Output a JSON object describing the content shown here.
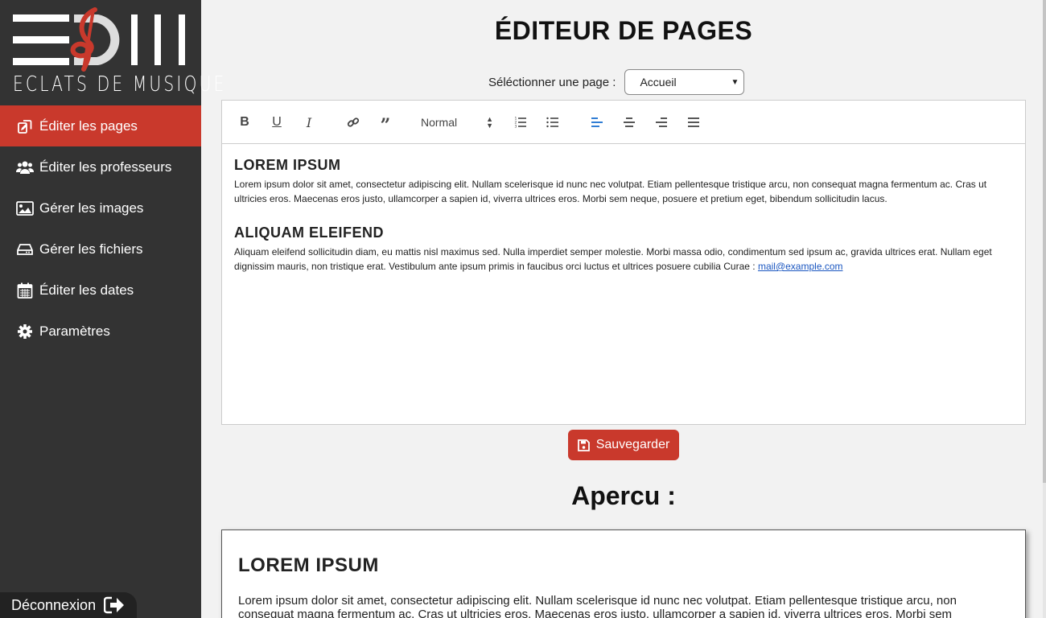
{
  "brand": {
    "name": "ECLATS DE MUSIQUE",
    "accent": "#c9392c",
    "sidebar_bg": "#333333"
  },
  "sidebar": {
    "items": [
      {
        "label": "Éditer les pages",
        "icon": "copy-edit-icon",
        "active": true
      },
      {
        "label": "Éditer les professeurs",
        "icon": "users-icon",
        "active": false
      },
      {
        "label": "Gérer les images",
        "icon": "image-icon",
        "active": false
      },
      {
        "label": "Gérer les fichiers",
        "icon": "drive-icon",
        "active": false
      },
      {
        "label": "Éditer les dates",
        "icon": "calendar-icon",
        "active": false
      },
      {
        "label": "Paramètres",
        "icon": "gear-icon",
        "active": false
      }
    ],
    "logout_label": "Déconnexion"
  },
  "main": {
    "title": "ÉDITEUR DE PAGES",
    "selector_label": "Séléctionner une page :",
    "selected_page": "Accueil",
    "toolbar": {
      "bold": "B",
      "underline": "U",
      "italic": "I",
      "quote": "”",
      "heading_value": "Normal",
      "active_align": "left"
    },
    "editor": {
      "heading1": "LOREM IPSUM",
      "para1": "Lorem ipsum dolor sit amet, consectetur adipiscing elit. Nullam scelerisque id nunc nec volutpat. Etiam pellentesque tristique arcu, non consequat magna fermentum ac. Cras ut ultricies eros. Maecenas eros justo, ullamcorper a sapien id, viverra ultrices eros. Morbi sem neque, posuere et pretium eget, bibendum sollicitudin lacus.",
      "heading2": "ALIQUAM ELEIFEND",
      "para2": "Aliquam eleifend sollicitudin diam, eu mattis nisl maximus sed. Nulla imperdiet semper molestie. Morbi massa odio, condimentum sed ipsum ac, gravida ultrices erat. Nullam eget dignissim mauris, non tristique erat. Vestibulum ante ipsum primis in faucibus orci luctus et ultrices posuere cubilia Curae : ",
      "link": "mail@example.com"
    },
    "save_label": "Sauvegarder",
    "preview_title": "Apercu :",
    "preview": {
      "heading": "LOREM IPSUM",
      "para": "Lorem ipsum dolor sit amet, consectetur adipiscing elit. Nullam scelerisque id nunc nec volutpat. Etiam pellentesque tristique arcu, non consequat magna fermentum ac. Cras ut ultricies eros. Maecenas eros justo, ullamcorper a sapien id, viverra ultrices eros. Morbi sem"
    }
  }
}
